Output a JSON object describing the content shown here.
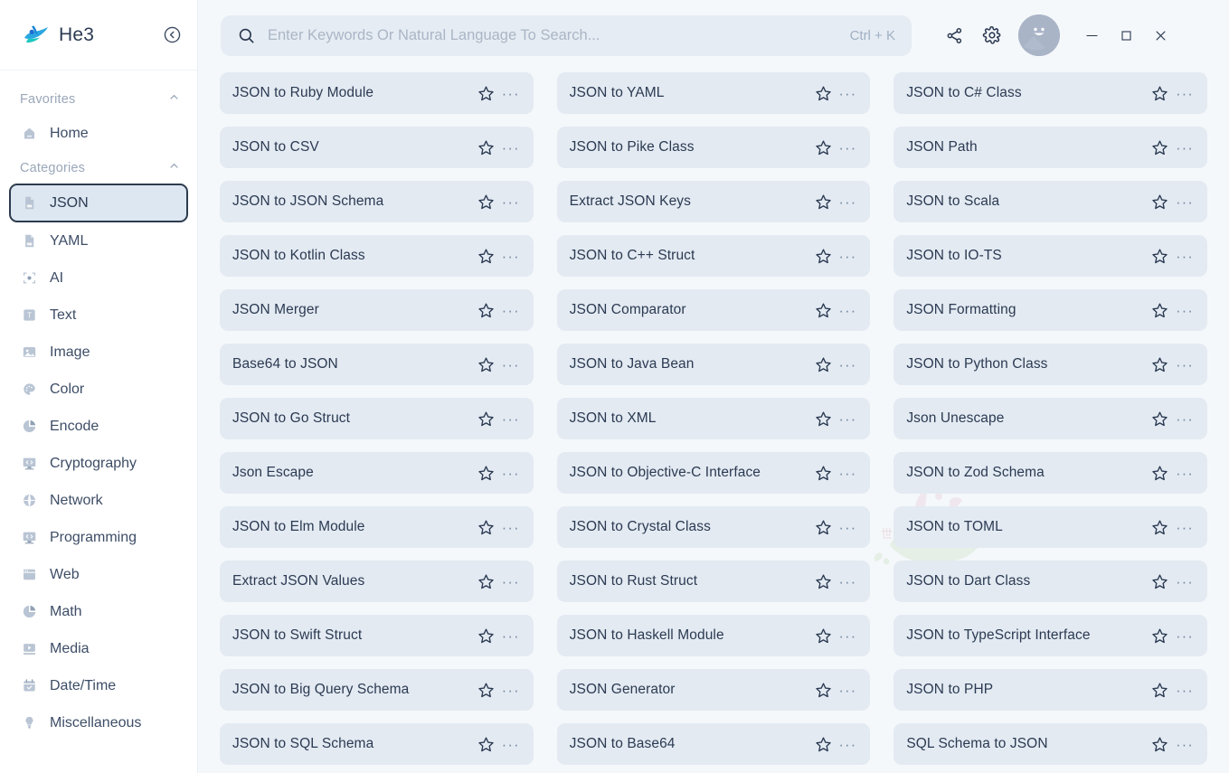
{
  "app": {
    "brand_name": "He3",
    "accent_color": "#1fb6d8",
    "card_bg": "#e3eaf2",
    "page_bg": "#f5f8fb"
  },
  "sidebar": {
    "collapse_icon": "chevron-left-circle-icon",
    "groups": [
      {
        "title": "Favorites",
        "chevron": "chevron-up-icon",
        "items": [
          {
            "label": "Home",
            "icon": "home-icon",
            "active": false
          }
        ]
      },
      {
        "title": "Categories",
        "chevron": "chevron-up-icon",
        "items": [
          {
            "label": "JSON",
            "icon": "json-file-icon",
            "active": true
          },
          {
            "label": "YAML",
            "icon": "yaml-file-icon",
            "active": false
          },
          {
            "label": "AI",
            "icon": "ai-icon",
            "active": false
          },
          {
            "label": "Text",
            "icon": "text-icon",
            "active": false
          },
          {
            "label": "Image",
            "icon": "image-icon",
            "active": false
          },
          {
            "label": "Color",
            "icon": "color-palette-icon",
            "active": false
          },
          {
            "label": "Encode",
            "icon": "pie-chart-icon",
            "active": false
          },
          {
            "label": "Cryptography",
            "icon": "monitor-code-icon",
            "active": false
          },
          {
            "label": "Network",
            "icon": "globe-icon",
            "active": false
          },
          {
            "label": "Programming",
            "icon": "monitor-code-icon",
            "active": false
          },
          {
            "label": "Web",
            "icon": "browser-icon",
            "active": false
          },
          {
            "label": "Math",
            "icon": "pie-chart-icon",
            "active": false
          },
          {
            "label": "Media",
            "icon": "play-icon",
            "active": false
          },
          {
            "label": "Date/Time",
            "icon": "calendar-icon",
            "active": false
          },
          {
            "label": "Miscellaneous",
            "icon": "lightbulb-icon",
            "active": false
          }
        ]
      }
    ]
  },
  "topbar": {
    "search": {
      "placeholder": "Enter Keywords Or Natural Language To Search...",
      "value": "",
      "icon": "search-icon",
      "shortcut": "Ctrl + K"
    },
    "actions": [
      {
        "name": "share-icon",
        "title": "Share"
      },
      {
        "name": "gear-icon",
        "title": "Settings"
      }
    ],
    "avatar": {
      "icon": "smiley-avatar-icon"
    },
    "window_controls": [
      {
        "name": "minimize-icon",
        "glyph": "—"
      },
      {
        "name": "maximize-icon",
        "glyph": "□"
      },
      {
        "name": "close-icon",
        "glyph": "✕"
      }
    ]
  },
  "tools": {
    "star_icon": "star-outline-icon",
    "more_icon": "ellipsis-icon",
    "columns": [
      [
        "JSON to Ruby Module",
        "JSON to CSV",
        "JSON to JSON Schema",
        "JSON to Kotlin Class",
        "JSON Merger",
        "Base64 to JSON",
        "JSON to Go Struct",
        "Json Escape",
        "JSON to Elm Module",
        "Extract JSON Values",
        "JSON to Swift Struct",
        "JSON to Big Query Schema",
        "JSON to SQL Schema"
      ],
      [
        "JSON to YAML",
        "JSON to Pike Class",
        "Extract JSON Keys",
        "JSON to C++ Struct",
        "JSON Comparator",
        "JSON to Java Bean",
        "JSON to XML",
        "JSON to Objective-C Interface",
        "JSON to Crystal Class",
        "JSON to Rust Struct",
        "JSON to Haskell Module",
        "JSON Generator",
        "JSON to Base64"
      ],
      [
        "JSON to C# Class",
        "JSON Path",
        "JSON to Scala",
        "JSON to IO-TS",
        "JSON Formatting",
        "JSON to Python Class",
        "Json Unescape",
        "JSON to Zod Schema",
        "JSON to TOML",
        "JSON to Dart Class",
        "JSON to TypeScript Interface",
        "JSON to PHP",
        "SQL Schema to JSON"
      ]
    ]
  }
}
